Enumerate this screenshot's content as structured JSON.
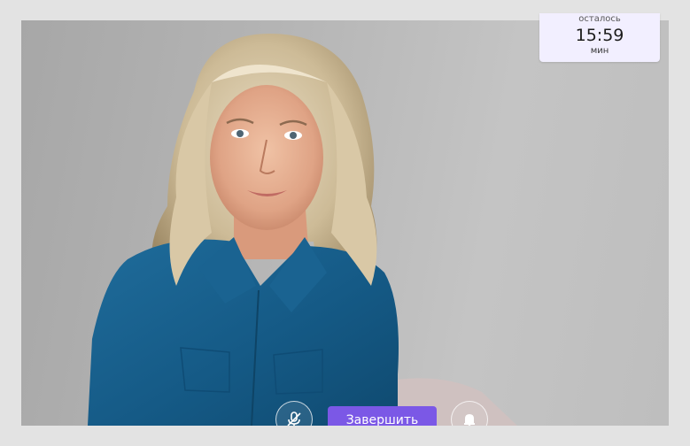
{
  "timer": {
    "label": "осталось",
    "value": "15:59",
    "unit": "мин"
  },
  "controls": {
    "mic_icon": "mic-off-icon",
    "end_label": "Завершить",
    "bell_icon": "bell-icon"
  },
  "colors": {
    "accent": "#7b58e6",
    "timer_bg": "#f2efff"
  }
}
